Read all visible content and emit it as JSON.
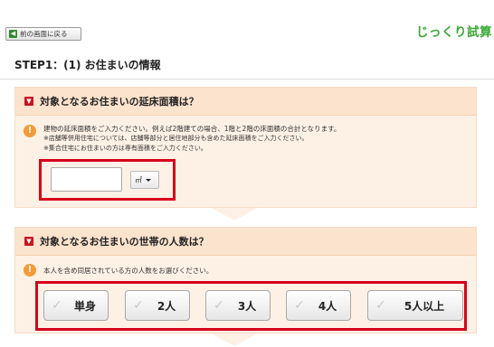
{
  "header": {
    "back_label": "前の画面に戻る",
    "brand": "じっくり試算"
  },
  "step": {
    "title": "STEP1：(1) お住まいの情報"
  },
  "floor_area": {
    "heading": "対象となるお住まいの延床面積は？",
    "description": "建物の延床面積をご入力ください。例えば2階建ての場合、1階と2階の床面積の合計となります。",
    "note_1": "※店舗等併用住宅については、店舗等部分と居住地部分も含めた延床面積をご入力ください。",
    "note_2": "※集合住宅にお住まいの方は専有面積をご入力ください。",
    "input_value": "",
    "unit_selected": "㎡"
  },
  "household": {
    "heading": "対象となるお住まいの世帯の人数は？",
    "description": "本人を含め同居されている方の人数をお選びください。",
    "options": [
      "単身",
      "2人",
      "3人",
      "4人",
      "5人以上"
    ]
  },
  "colors": {
    "accent_red": "#d7001c",
    "brand_green": "#3aaa35",
    "info_orange": "#f29b38",
    "card_bg": "#fdf1e6",
    "card_head_bg": "#fce3cd"
  }
}
